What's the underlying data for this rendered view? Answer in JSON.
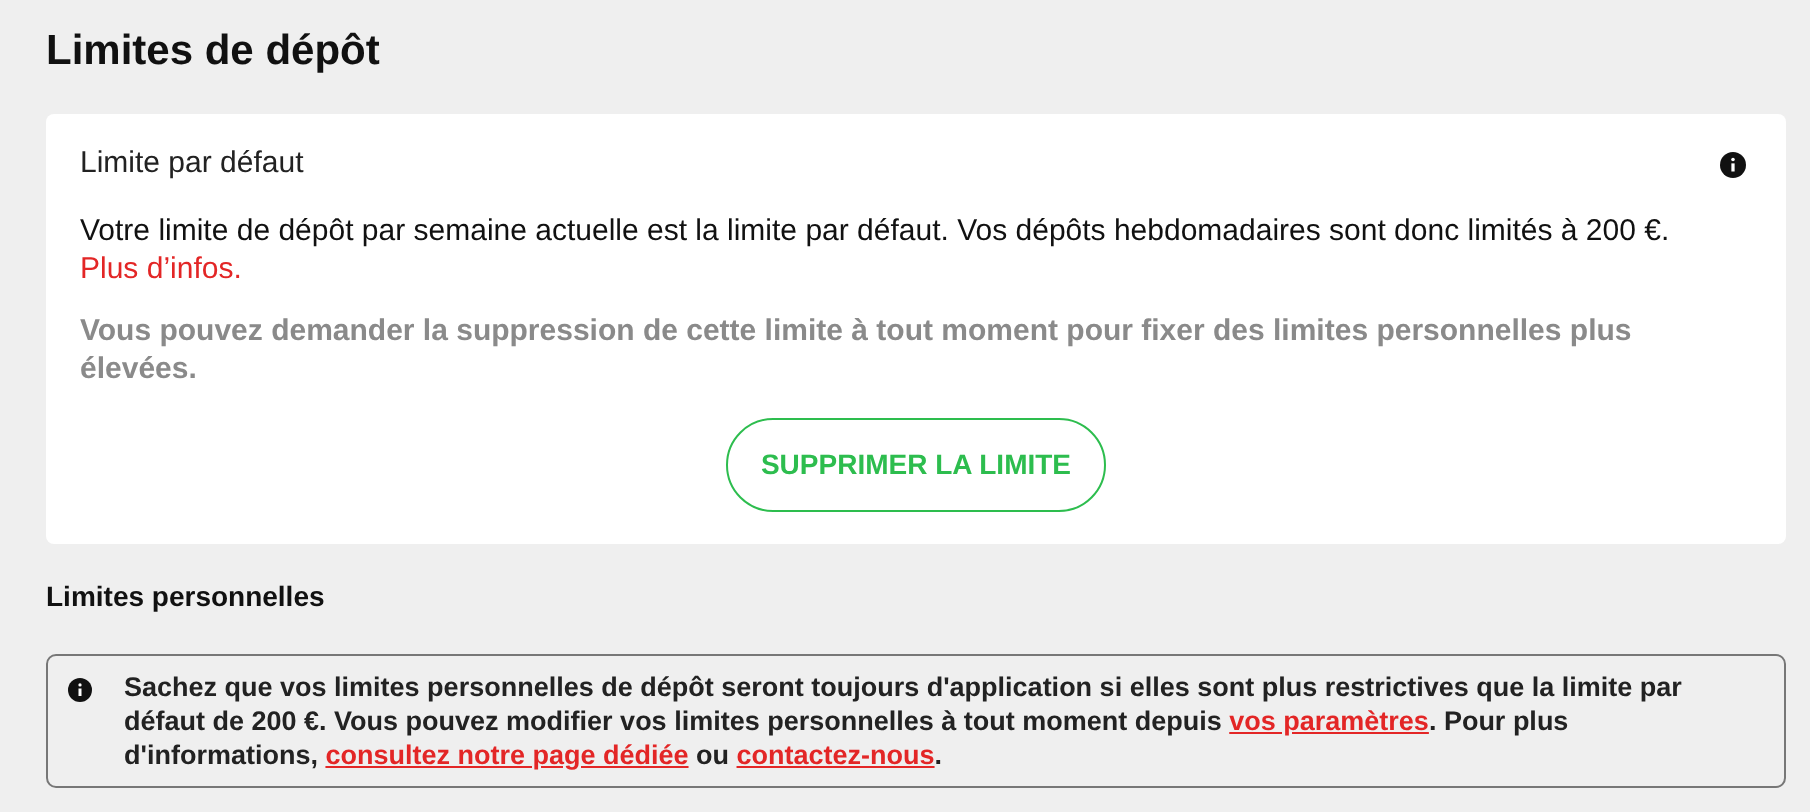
{
  "title": "Limites de dépôt",
  "default_limit": {
    "heading": "Limite par défaut",
    "text": "Votre limite de dépôt par semaine actuelle est la limite par défaut. Vos dépôts hebdomadaires sont donc limités à 200 €.",
    "link": "Plus d’infos.",
    "note": "Vous pouvez demander la suppression de cette limite à tout moment pour fixer des limites personnelles plus élevées.",
    "button": "SUPPRIMER LA LIMITE"
  },
  "personal_limits": {
    "heading": "Limites personnelles",
    "notice": [
      {
        "kind": "text",
        "text": "Sachez que vos limites personnelles de dépôt seront toujours d'application si elles sont plus restrictives que la limite par défaut de 200 €. Vous pouvez modifier vos limites personnelles à tout moment depuis "
      },
      {
        "kind": "link",
        "text": "vos paramètres"
      },
      {
        "kind": "text",
        "text": ". Pour plus d'informations, "
      },
      {
        "kind": "link",
        "text": "consultez notre page dédiée"
      },
      {
        "kind": "text",
        "text": " ou "
      },
      {
        "kind": "link",
        "text": "contactez-nous"
      },
      {
        "kind": "text",
        "text": "."
      }
    ]
  }
}
